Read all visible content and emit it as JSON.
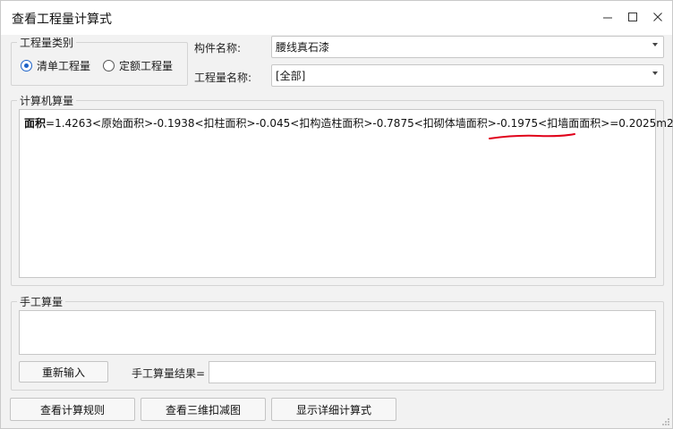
{
  "window": {
    "title": "查看工程量计算式"
  },
  "quantity_type": {
    "legend": "工程量类别",
    "options": [
      {
        "label": "清单工程量",
        "checked": true
      },
      {
        "label": "定额工程量",
        "checked": false
      }
    ]
  },
  "component": {
    "label": "构件名称:",
    "value": "腰线真石漆"
  },
  "quantity_name": {
    "label": "工程量名称:",
    "value": "[全部]"
  },
  "computer_calc": {
    "legend": "计算机算量",
    "formula": {
      "prefix": "面积",
      "rest": "=1.4263<原始面积>-0.1938<扣柱面积>-0.045<扣构造柱面积>-0.7875<扣砌体墙面积>-0.1975<扣墙面面积>=0.2025m2"
    },
    "annotation_color": "#e0001a"
  },
  "manual_calc": {
    "legend": "手工算量",
    "reinput_button": "重新输入",
    "result_label": "手工算量结果=",
    "result_value": ""
  },
  "footer": {
    "buttons": [
      "查看计算规则",
      "查看三维扣减图",
      "显示详细计算式"
    ]
  },
  "colors": {
    "accent": "#1e63c8",
    "background": "#f2f2f2"
  }
}
